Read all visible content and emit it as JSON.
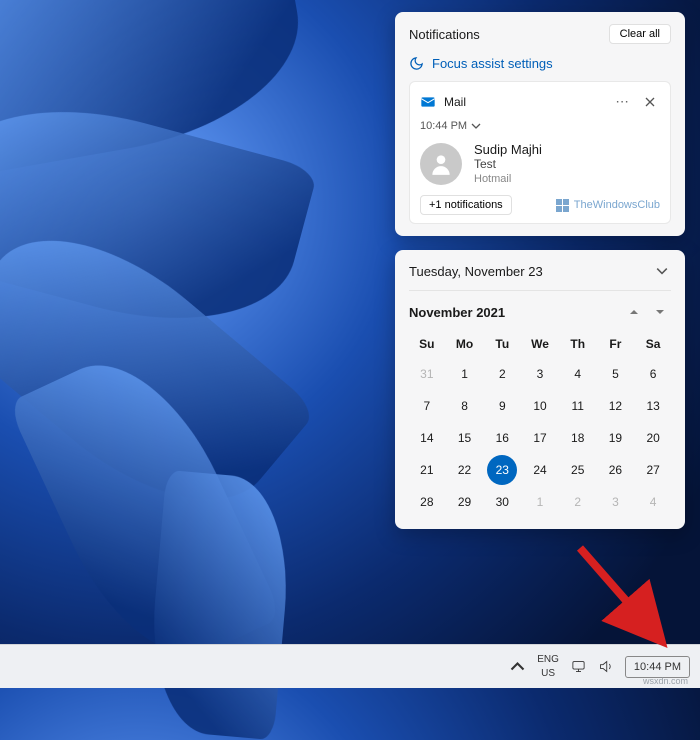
{
  "notifications": {
    "title": "Notifications",
    "clear_all": "Clear all",
    "focus_assist": "Focus assist settings",
    "mail": {
      "app_name": "Mail",
      "time": "10:44 PM",
      "sender": "Sudip Majhi",
      "subject": "Test",
      "account": "Hotmail",
      "expand": "+1 notifications"
    },
    "watermark": "TheWindowsClub"
  },
  "calendar": {
    "today_label": "Tuesday, November 23",
    "month_label": "November 2021",
    "dow": [
      "Su",
      "Mo",
      "Tu",
      "We",
      "Th",
      "Fr",
      "Sa"
    ],
    "weeks": [
      [
        {
          "d": "31",
          "muted": true
        },
        {
          "d": "1"
        },
        {
          "d": "2"
        },
        {
          "d": "3"
        },
        {
          "d": "4"
        },
        {
          "d": "5"
        },
        {
          "d": "6"
        }
      ],
      [
        {
          "d": "7"
        },
        {
          "d": "8"
        },
        {
          "d": "9"
        },
        {
          "d": "10"
        },
        {
          "d": "11"
        },
        {
          "d": "12"
        },
        {
          "d": "13"
        }
      ],
      [
        {
          "d": "14"
        },
        {
          "d": "15"
        },
        {
          "d": "16"
        },
        {
          "d": "17"
        },
        {
          "d": "18"
        },
        {
          "d": "19"
        },
        {
          "d": "20"
        }
      ],
      [
        {
          "d": "21"
        },
        {
          "d": "22"
        },
        {
          "d": "23",
          "today": true
        },
        {
          "d": "24"
        },
        {
          "d": "25"
        },
        {
          "d": "26"
        },
        {
          "d": "27"
        }
      ],
      [
        {
          "d": "28"
        },
        {
          "d": "29"
        },
        {
          "d": "30"
        },
        {
          "d": "1",
          "muted": true
        },
        {
          "d": "2",
          "muted": true
        },
        {
          "d": "3",
          "muted": true
        },
        {
          "d": "4",
          "muted": true
        }
      ]
    ]
  },
  "taskbar": {
    "lang_top": "ENG",
    "lang_bottom": "US",
    "clock": "10:44 PM",
    "subtext": "wsxdn.com"
  }
}
